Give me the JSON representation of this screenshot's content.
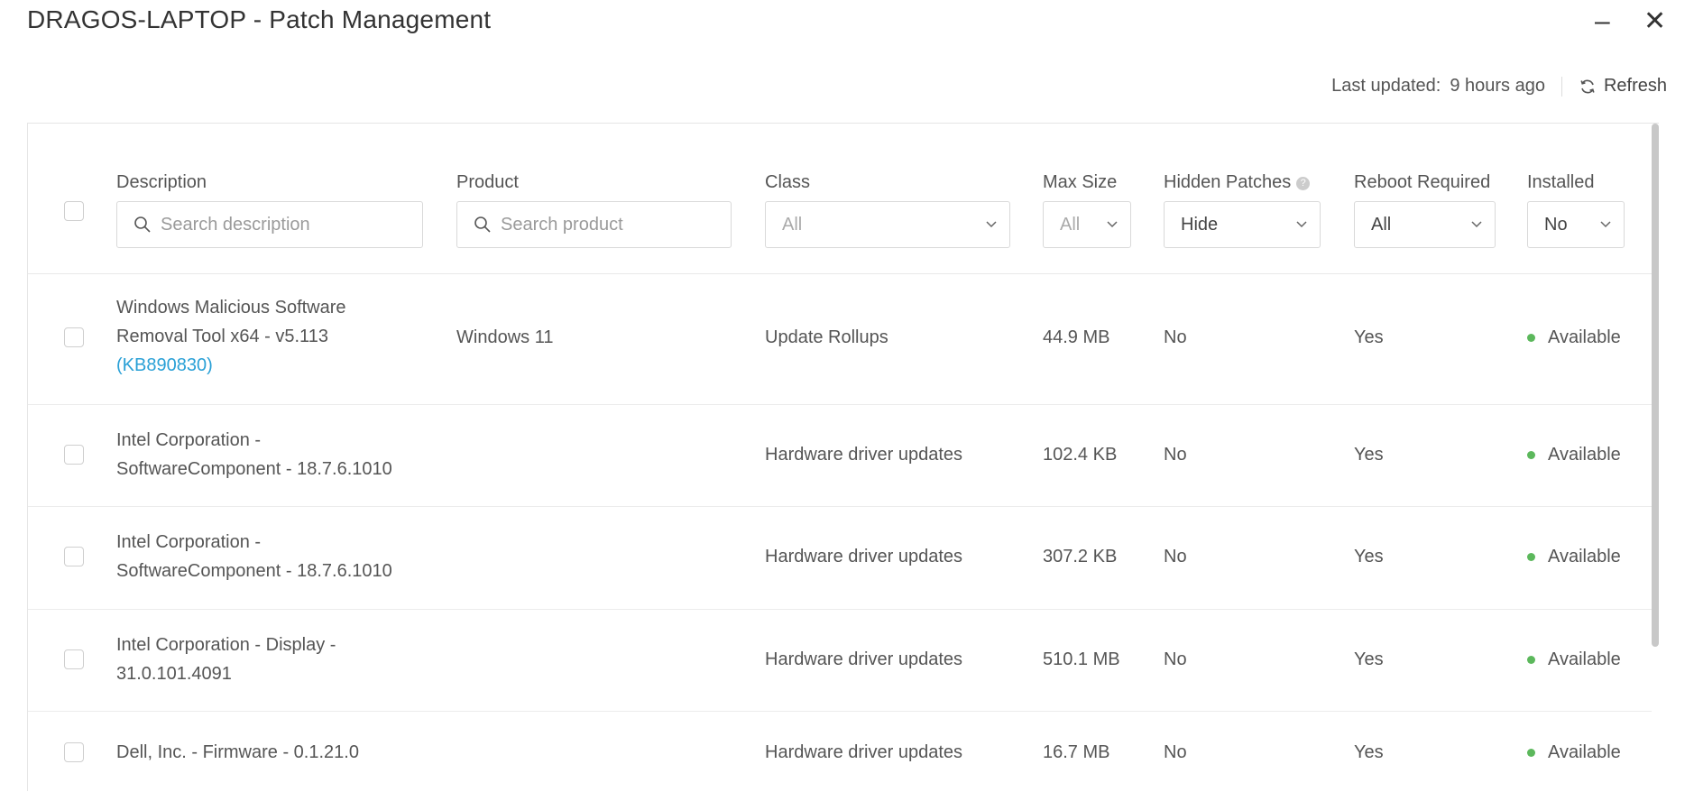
{
  "window": {
    "title": "DRAGOS-LAPTOP - Patch Management",
    "minimize_glyph": "–",
    "close_glyph": "✕"
  },
  "toolbar": {
    "last_updated_label": "Last updated:",
    "last_updated_value": "9 hours ago",
    "refresh_label": "Refresh"
  },
  "columns": {
    "description": "Description",
    "product": "Product",
    "class": "Class",
    "max_size": "Max Size",
    "hidden_patches": "Hidden Patches",
    "reboot_required": "Reboot Required",
    "installed": "Installed"
  },
  "filters": {
    "description_placeholder": "Search description",
    "product_placeholder": "Search product",
    "class_value": "All",
    "max_size_value": "All",
    "hidden_patches_value": "Hide",
    "reboot_required_value": "All",
    "installed_value": "No"
  },
  "rows": [
    {
      "description_lines": [
        "Windows Malicious Software",
        "Removal Tool x64 - v5.113"
      ],
      "kb": "(KB890830)",
      "product": "Windows 11",
      "class": "Update Rollups",
      "size": "44.9 MB",
      "hidden": "No",
      "reboot": "Yes",
      "status": "Available"
    },
    {
      "description_lines": [
        "Intel Corporation -",
        "SoftwareComponent - 18.7.6.1010"
      ],
      "kb": "",
      "product": "",
      "class": "Hardware driver updates",
      "size": "102.4 KB",
      "hidden": "No",
      "reboot": "Yes",
      "status": "Available"
    },
    {
      "description_lines": [
        "Intel Corporation -",
        "SoftwareComponent - 18.7.6.1010"
      ],
      "kb": "",
      "product": "",
      "class": "Hardware driver updates",
      "size": "307.2 KB",
      "hidden": "No",
      "reboot": "Yes",
      "status": "Available"
    },
    {
      "description_lines": [
        "Intel Corporation - Display -",
        "31.0.101.4091"
      ],
      "kb": "",
      "product": "",
      "class": "Hardware driver updates",
      "size": "510.1 MB",
      "hidden": "No",
      "reboot": "Yes",
      "status": "Available"
    },
    {
      "description_lines": [
        "Dell, Inc. - Firmware - 0.1.21.0"
      ],
      "kb": "",
      "product": "",
      "class": "Hardware driver updates",
      "size": "16.7 MB",
      "hidden": "No",
      "reboot": "Yes",
      "status": "Available"
    }
  ],
  "colors": {
    "status_available": "#5cb85c",
    "kb_link": "#2aa0d6"
  }
}
